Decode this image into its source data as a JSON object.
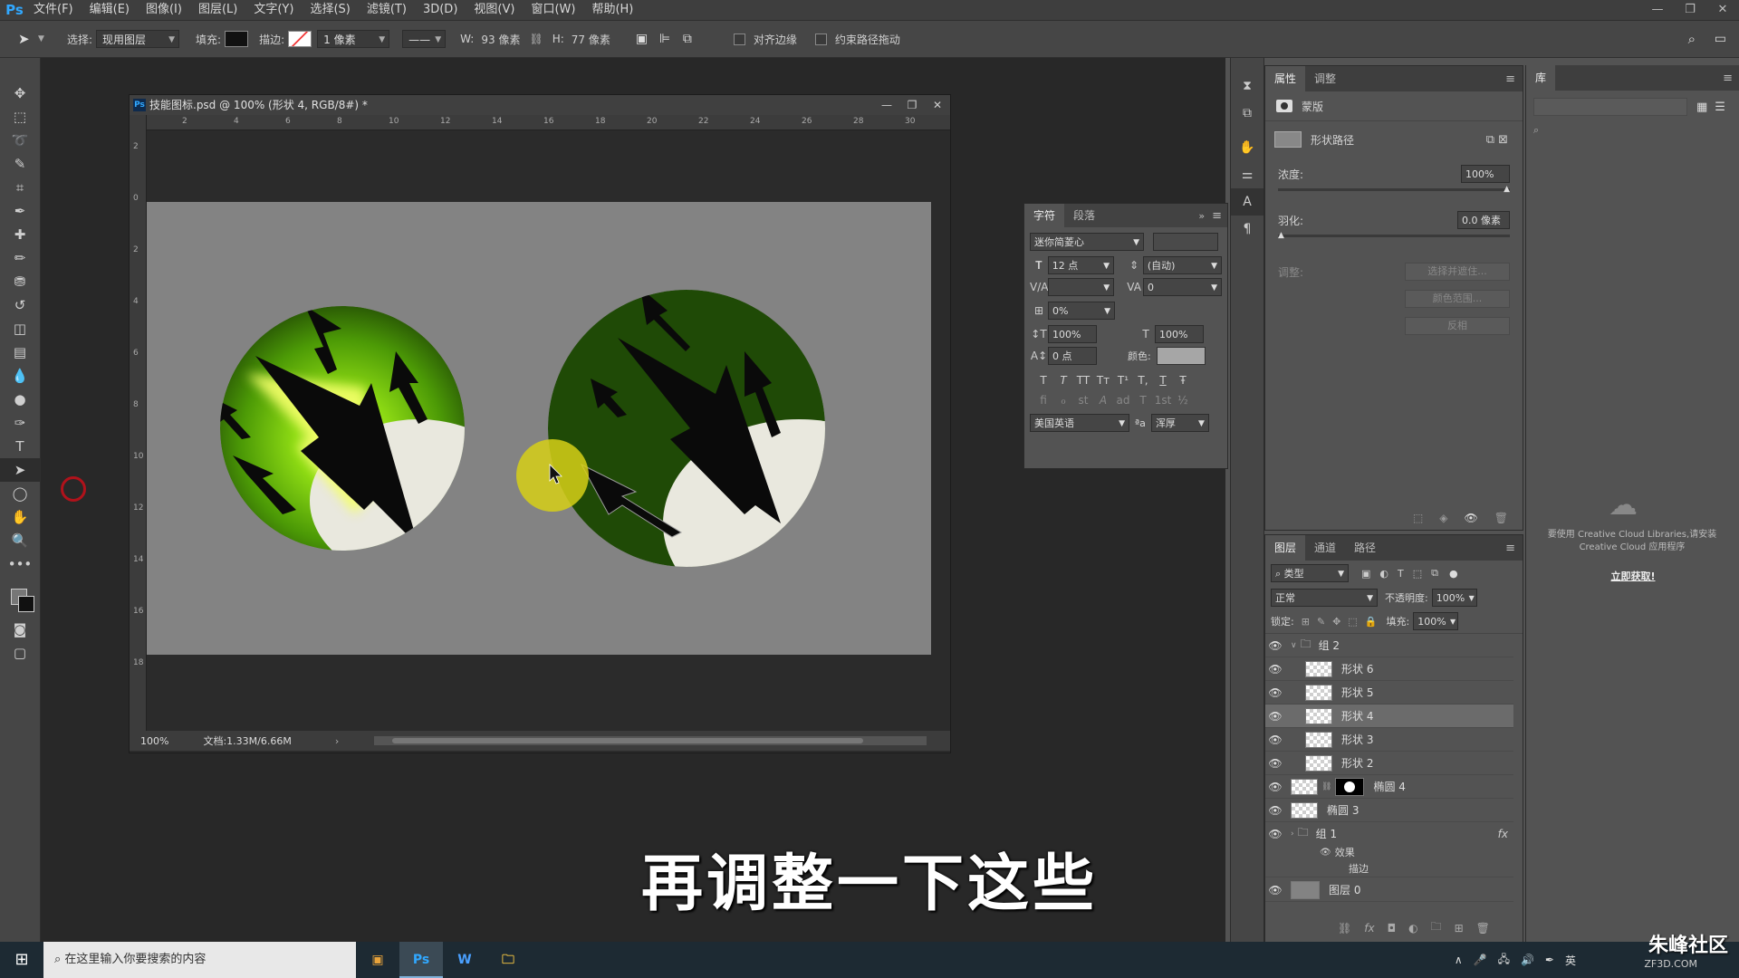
{
  "app": {
    "logo": "Ps"
  },
  "menu": [
    "文件(F)",
    "编辑(E)",
    "图像(I)",
    "图层(L)",
    "文字(Y)",
    "选择(S)",
    "滤镜(T)",
    "3D(D)",
    "视图(V)",
    "窗口(W)",
    "帮助(H)"
  ],
  "window_controls": [
    "—",
    "❐",
    "✕"
  ],
  "options_bar": {
    "select_label": "选择:",
    "select_value": "现用图层",
    "fill_label": "填充:",
    "stroke_label": "描边:",
    "stroke_width": "1 像素",
    "w_label": "W:",
    "w_value": "93 像素",
    "h_label": "H:",
    "h_value": "77 像素",
    "align_edges": "对齐边缘",
    "constrain_path": "约束路径拖动"
  },
  "document": {
    "title": "技能图标.psd @ 100% (形状 4, RGB/8#) *",
    "ruler_h": [
      "2",
      "4",
      "6",
      "8",
      "10",
      "12",
      "14",
      "16",
      "18",
      "20",
      "22",
      "24",
      "26",
      "28",
      "30"
    ],
    "ruler_v": [
      "2",
      "0",
      "2",
      "4",
      "6",
      "8",
      "10",
      "12",
      "14",
      "16",
      "18"
    ],
    "zoom": "100%",
    "doc_info": "文档:1.33M/6.66M"
  },
  "character_panel": {
    "tabs": [
      "字符",
      "段落"
    ],
    "font_family": "迷你简菱心",
    "font_size": "12 点",
    "leading": "(自动)",
    "kerning": "",
    "tracking": "0",
    "scale_pct": "0%",
    "vscale": "100%",
    "hscale": "100%",
    "baseline": "0 点",
    "color_label": "颜色:",
    "style_buttons": [
      "T",
      "T",
      "TT",
      "Tт",
      "T¹",
      "T,",
      "T",
      "Ŧ"
    ],
    "opentype_buttons": [
      "fi",
      "ℴ",
      "st",
      "A",
      "ad",
      "T",
      "1st",
      "½"
    ],
    "language": "美国英语",
    "aa_label": "ªa",
    "antialias": "浑厚"
  },
  "properties_panel": {
    "tabs": [
      "属性",
      "调整"
    ],
    "mask_label": "蒙版",
    "shape_path": "形状路径",
    "density_label": "浓度:",
    "density_value": "100%",
    "feather_label": "羽化:",
    "feather_value": "0.0 像素",
    "adjust_label": "调整:",
    "buttons": [
      "选择并遮住...",
      "颜色范围...",
      "反相"
    ]
  },
  "layers_panel": {
    "tabs": [
      "图层",
      "通道",
      "路径"
    ],
    "filter_kind": "类型",
    "blend_mode": "正常",
    "opacity_label": "不透明度:",
    "opacity_value": "100%",
    "lock_label": "锁定:",
    "fill_label": "填充:",
    "fill_value": "100%",
    "layers": [
      {
        "name": "组 2",
        "type": "group",
        "indent": 0
      },
      {
        "name": "形状 6",
        "type": "shape",
        "indent": 1
      },
      {
        "name": "形状 5",
        "type": "shape",
        "indent": 1
      },
      {
        "name": "形状 4",
        "type": "shape",
        "indent": 1,
        "selected": true
      },
      {
        "name": "形状 3",
        "type": "shape",
        "indent": 1
      },
      {
        "name": "形状 2",
        "type": "shape",
        "indent": 1
      },
      {
        "name": "椭圆 4",
        "type": "masked",
        "indent": 0
      },
      {
        "name": "椭圆 3",
        "type": "shape",
        "indent": 0
      },
      {
        "name": "组 1",
        "type": "group",
        "indent": 0,
        "fx": "fx"
      },
      {
        "name": "效果",
        "type": "effect",
        "indent": 1
      },
      {
        "name": "描边",
        "type": "effect",
        "indent": 2
      },
      {
        "name": "图层 0",
        "type": "pixel",
        "indent": 0
      }
    ]
  },
  "library_panel": {
    "tab": "库",
    "message": "要使用 Creative Cloud Libraries,请安装 Creative Cloud 应用程序",
    "link": "立即获取!"
  },
  "subtitle": "再调整一下这些",
  "taskbar": {
    "search_placeholder": "在这里输入你要搜索的内容",
    "apps": [
      "Ps",
      "W"
    ],
    "ime": "英"
  },
  "watermark": {
    "main": "朱峰社区",
    "sub": "ZF3D.COM"
  },
  "colors": {
    "accent": "#31a8ff",
    "dark_green": "#1f4a06",
    "bright_green": "#7ed10f",
    "highlight": "#e8e8dc"
  }
}
